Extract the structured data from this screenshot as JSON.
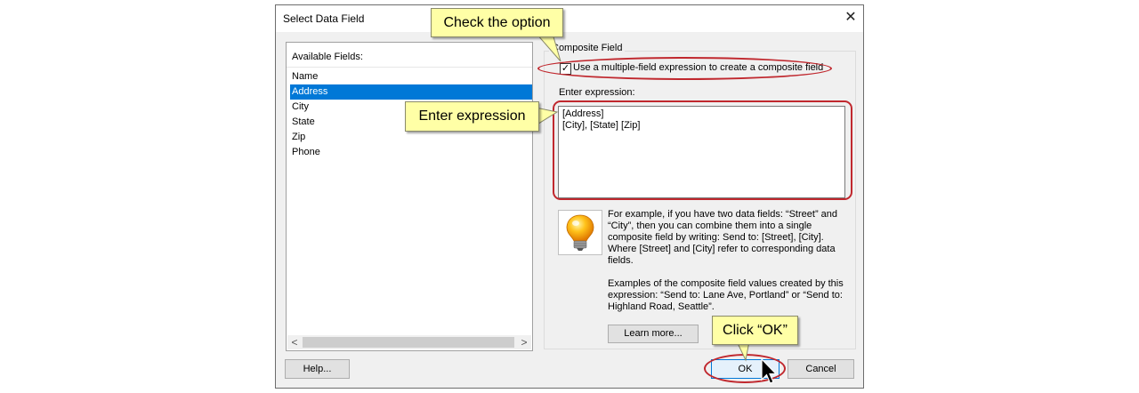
{
  "dialog": {
    "title": "Select Data Field",
    "close_icon": "close-icon"
  },
  "fields": {
    "header": "Available Fields:",
    "items": [
      "Name",
      "Address",
      "City",
      "State",
      "Zip",
      "Phone"
    ],
    "selected": "Address",
    "scroll_left": "<",
    "scroll_right": ">"
  },
  "composite": {
    "legend": "Composite Field",
    "checkbox_label": "Use a multiple-field expression to create a composite field",
    "checkbox_checked": true,
    "checkbox_mark": "✓",
    "expression_label": "Enter expression:",
    "expression_value": "[Address]\n[City], [State] [Zip]"
  },
  "hint": {
    "icon": "lightbulb-icon",
    "paragraph1": "For example, if you have two data fields: “Street” and “City”, then you can combine them into a single composite field by writing: Send to: [Street], [City]. Where [Street] and [City] refer to corresponding data fields.",
    "paragraph2": "Examples of the composite field values created by this expression: “Send to: Lane Ave, Portland” or “Send to: Highland Road, Seattle”."
  },
  "buttons": {
    "learn_more": "Learn more...",
    "help": "Help...",
    "ok": "OK",
    "cancel": "Cancel"
  },
  "annotations": {
    "check_callout": "Check the option",
    "expression_callout": "Enter expression",
    "ok_callout": "Click “OK”",
    "ring_color": "#c0282e",
    "callout_color": "#ffffa6"
  },
  "colors": {
    "selection": "#0078d7",
    "dialog_bg": "#f0f0f0"
  }
}
